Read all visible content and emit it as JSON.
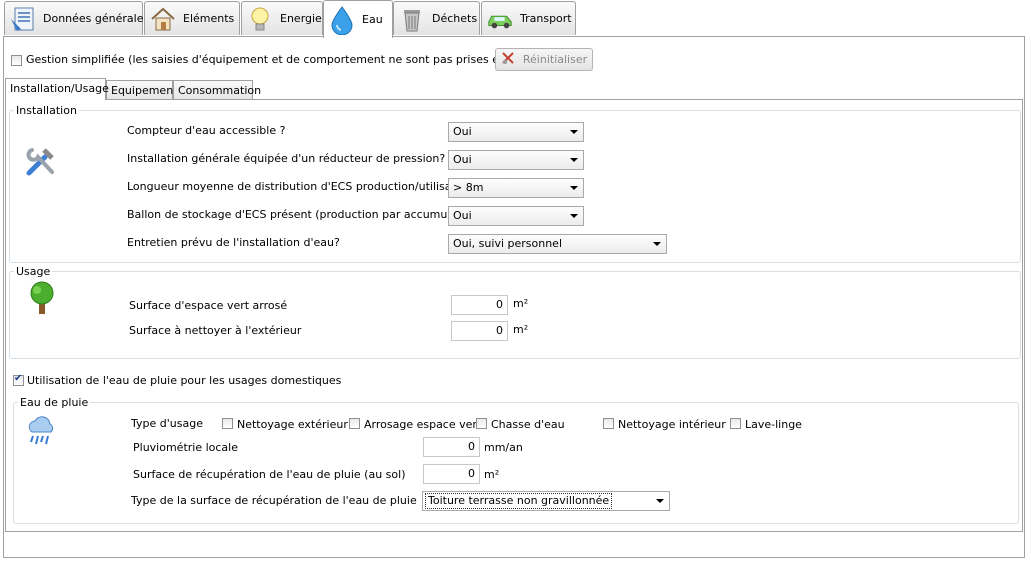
{
  "tabs": [
    {
      "label": "Données générales",
      "icon": "form-icon"
    },
    {
      "label": "Eléments",
      "icon": "house-icon"
    },
    {
      "label": "Energie",
      "icon": "lightbulb-icon"
    },
    {
      "label": "Eau",
      "icon": "water-drop-icon"
    },
    {
      "label": "Déchets",
      "icon": "trash-bin-icon"
    },
    {
      "label": "Transport",
      "icon": "car-icon"
    }
  ],
  "active_tab": "Eau",
  "simplified": {
    "label": "Gestion simplifiée (les saisies d'équipement et de comportement ne sont pas prises en compte)",
    "checked": false
  },
  "reset_button": {
    "label": "Réinitialiser",
    "enabled": false
  },
  "subtabs": [
    "Installation/Usage",
    "Equipement",
    "Consommation"
  ],
  "installation": {
    "title": "Installation",
    "icon": "tools-icon",
    "rows": [
      {
        "label": "Compteur d'eau accessible ?",
        "value": "Oui"
      },
      {
        "label": "Installation générale équipée d'un réducteur de pression?",
        "value": "Oui"
      },
      {
        "label": "Longueur moyenne de distribution d'ECS production/utilisation?",
        "value": "> 8m"
      },
      {
        "label": "Ballon de stockage d'ECS présent (production par accumulation)?",
        "value": "Oui"
      },
      {
        "label": "Entretien prévu de l'installation d'eau?",
        "value": "Oui, suivi personnel"
      }
    ]
  },
  "usage": {
    "title": "Usage",
    "icon": "tree-icon",
    "rows": [
      {
        "label": "Surface d'espace vert arrosé",
        "value": "0",
        "unit": "m²"
      },
      {
        "label": "Surface à nettoyer à l'extérieur",
        "value": "0",
        "unit": "m²"
      }
    ]
  },
  "rainwater_use": {
    "label": "Utilisation de l'eau de pluie pour les usages domestiques",
    "checked": true
  },
  "rainwater": {
    "title": "Eau de pluie",
    "icon": "rain-cloud-icon",
    "usage_type_label": "Type d'usage",
    "usage_types": [
      {
        "label": "Nettoyage extérieur",
        "checked": false
      },
      {
        "label": "Arrosage espace vert",
        "checked": false
      },
      {
        "label": "Chasse d'eau",
        "checked": false
      },
      {
        "label": "Nettoyage intérieur",
        "checked": false
      },
      {
        "label": "Lave-linge",
        "checked": false
      }
    ],
    "pluviometrie": {
      "label": "Pluviométrie locale",
      "value": "0",
      "unit": "mm/an"
    },
    "surface": {
      "label": "Surface de récupération de l'eau de pluie (au sol)",
      "value": "0",
      "unit": "m²"
    },
    "surface_type": {
      "label": "Type de la surface de récupération de l'eau de pluie",
      "value": "Toiture terrasse non gravillonnée"
    }
  }
}
